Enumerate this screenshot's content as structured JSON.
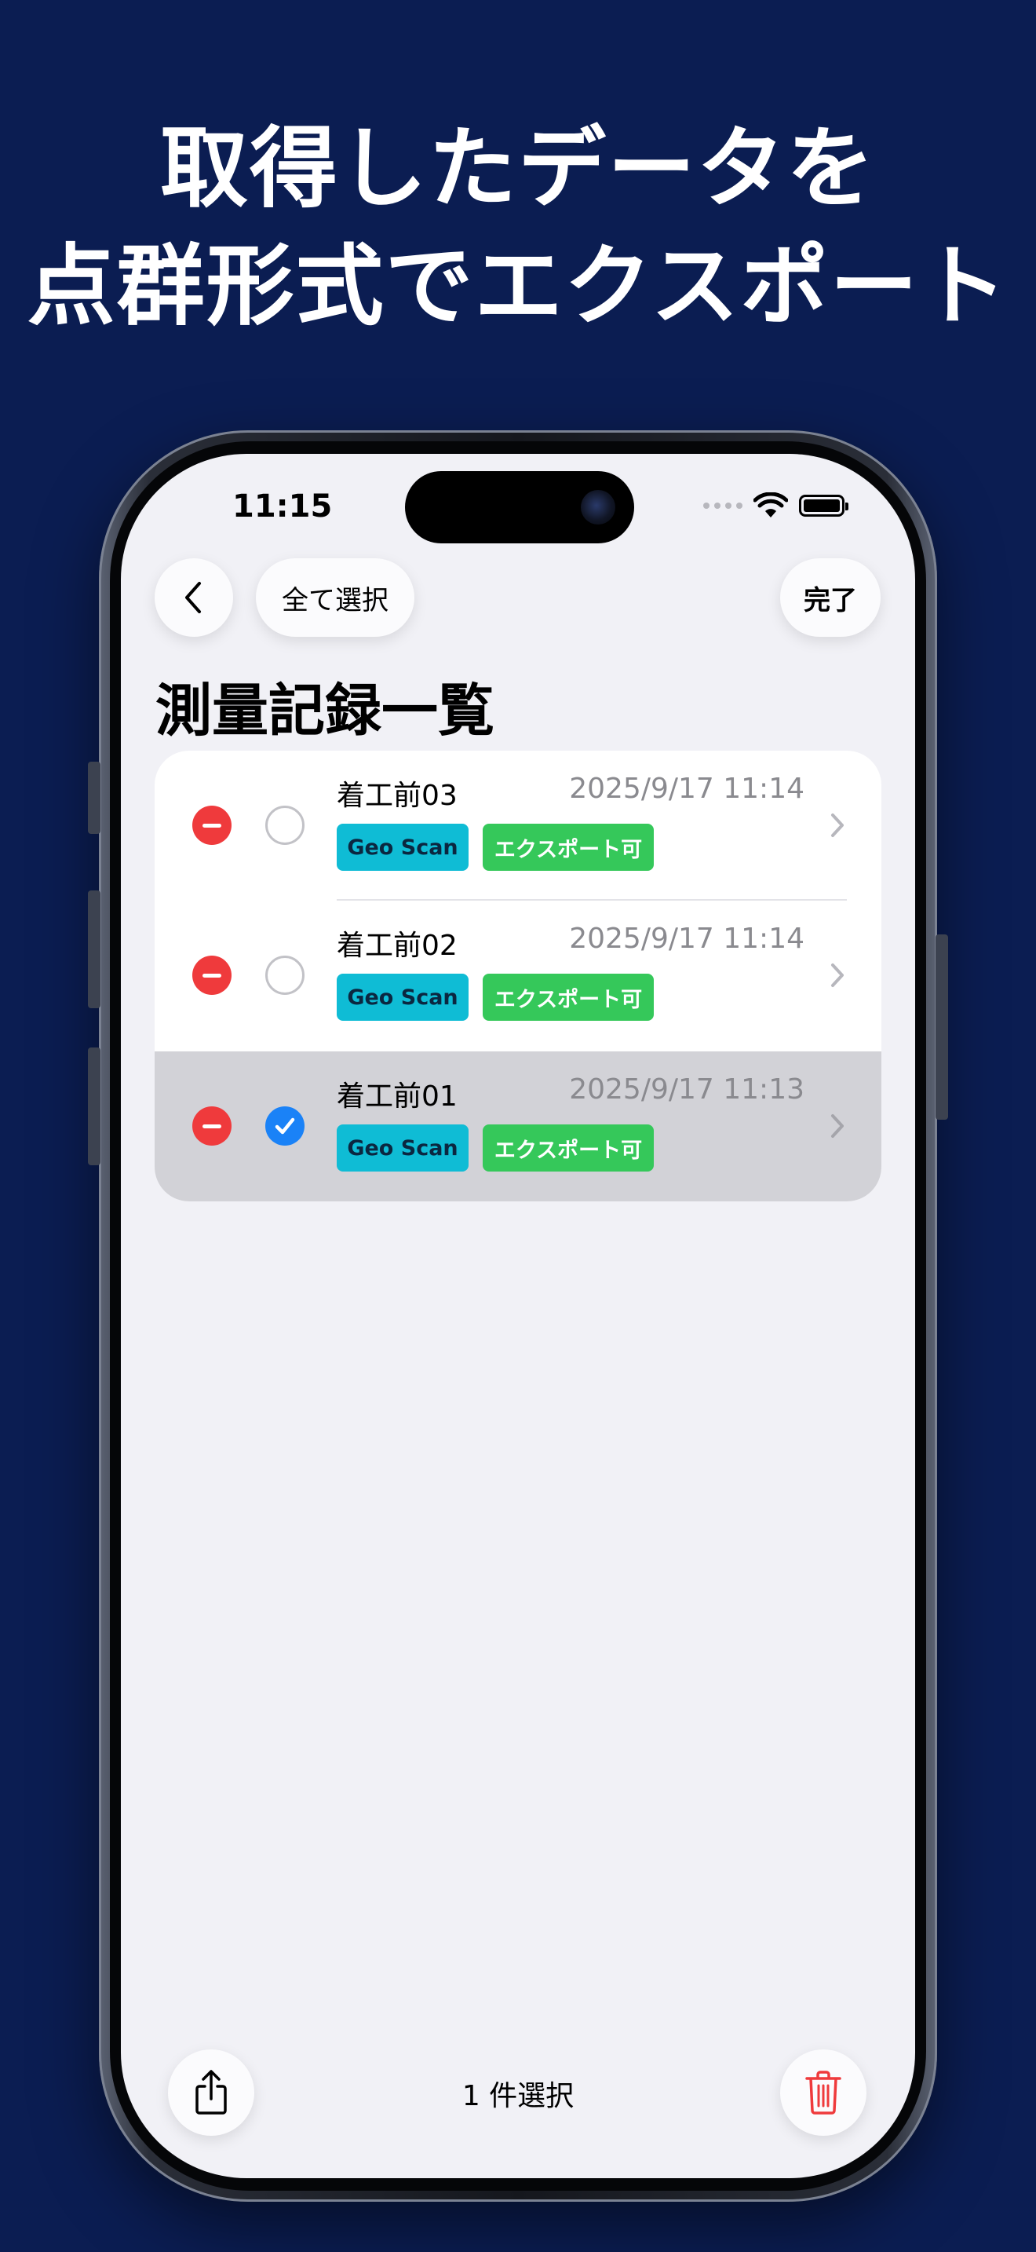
{
  "headline": {
    "line1": "取得したデータを",
    "line2": "点群形式でエクスポート"
  },
  "status_bar": {
    "time": "11:15"
  },
  "nav": {
    "select_all_label": "全て選択",
    "done_label": "完了"
  },
  "page_title": "測量記録一覧",
  "records": [
    {
      "title": "着工前03",
      "date": "2025/9/17 11:14",
      "tag_source": "Geo Scan",
      "tag_status": "エクスポート可",
      "selected": false
    },
    {
      "title": "着工前02",
      "date": "2025/9/17 11:14",
      "tag_source": "Geo Scan",
      "tag_status": "エクスポート可",
      "selected": false
    },
    {
      "title": "着工前01",
      "date": "2025/9/17 11:13",
      "tag_source": "Geo Scan",
      "tag_status": "エクスポート可",
      "selected": true
    }
  ],
  "toolbar": {
    "selected_count_label": "1 件選択"
  },
  "colors": {
    "background": "#0b1d52",
    "delete_red": "#ef3a3c",
    "check_blue": "#1a82f7",
    "geo_tag": "#0fbcd5",
    "export_tag": "#35c85a",
    "trash_red": "#ef3a3c"
  },
  "icons": {
    "back": "chevron-left-icon",
    "delete": "minus-circle-icon",
    "select": "radio-circle-icon",
    "checked": "checkmark-circle-icon",
    "disclosure": "chevron-right-icon",
    "share": "share-icon",
    "trash": "trash-icon"
  }
}
